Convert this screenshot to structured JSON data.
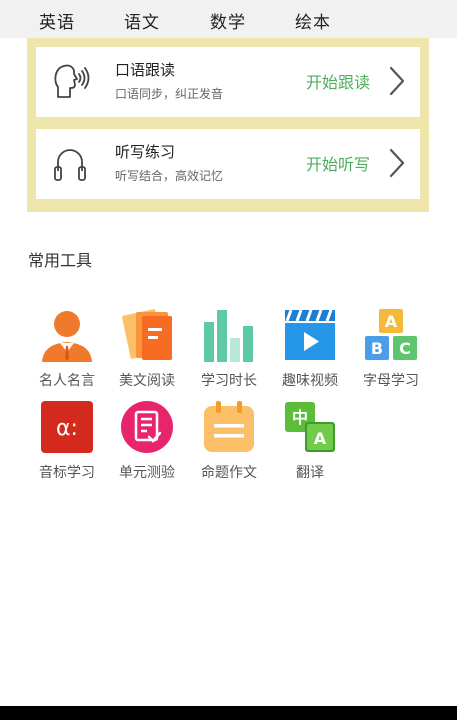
{
  "tabs": [
    {
      "label": "英语"
    },
    {
      "label": "语文"
    },
    {
      "label": "数学"
    },
    {
      "label": "绘本"
    }
  ],
  "practice": {
    "speaking": {
      "title": "口语跟读",
      "subtitle": "口语同步，纠正发音",
      "action": "开始跟读",
      "icon": "speaking-head-icon"
    },
    "dictation": {
      "title": "听写练习",
      "subtitle": "听写结合，高效记忆",
      "action": "开始听写",
      "icon": "headphones-icon"
    },
    "panel_color": "#efe6ad",
    "action_color": "#4cae5e"
  },
  "tools_section": {
    "title": "常用工具",
    "items": [
      {
        "label": "名人名言",
        "icon": "famous-person-icon"
      },
      {
        "label": "美文阅读",
        "icon": "reading-book-icon"
      },
      {
        "label": "学习时长",
        "icon": "bar-chart-icon"
      },
      {
        "label": "趣味视频",
        "icon": "video-clapper-icon"
      },
      {
        "label": "字母学习",
        "icon": "abc-blocks-icon"
      },
      {
        "label": "音标学习",
        "icon": "phonetic-symbol-icon"
      },
      {
        "label": "单元测验",
        "icon": "quiz-document-icon"
      },
      {
        "label": "命题作文",
        "icon": "calendar-essay-icon"
      },
      {
        "label": "翻译",
        "icon": "translate-icon"
      }
    ],
    "icon_glyphs": {
      "abc": [
        "A",
        "B",
        "C"
      ],
      "phonetic": "α:",
      "translate": [
        "中",
        "A"
      ]
    }
  }
}
